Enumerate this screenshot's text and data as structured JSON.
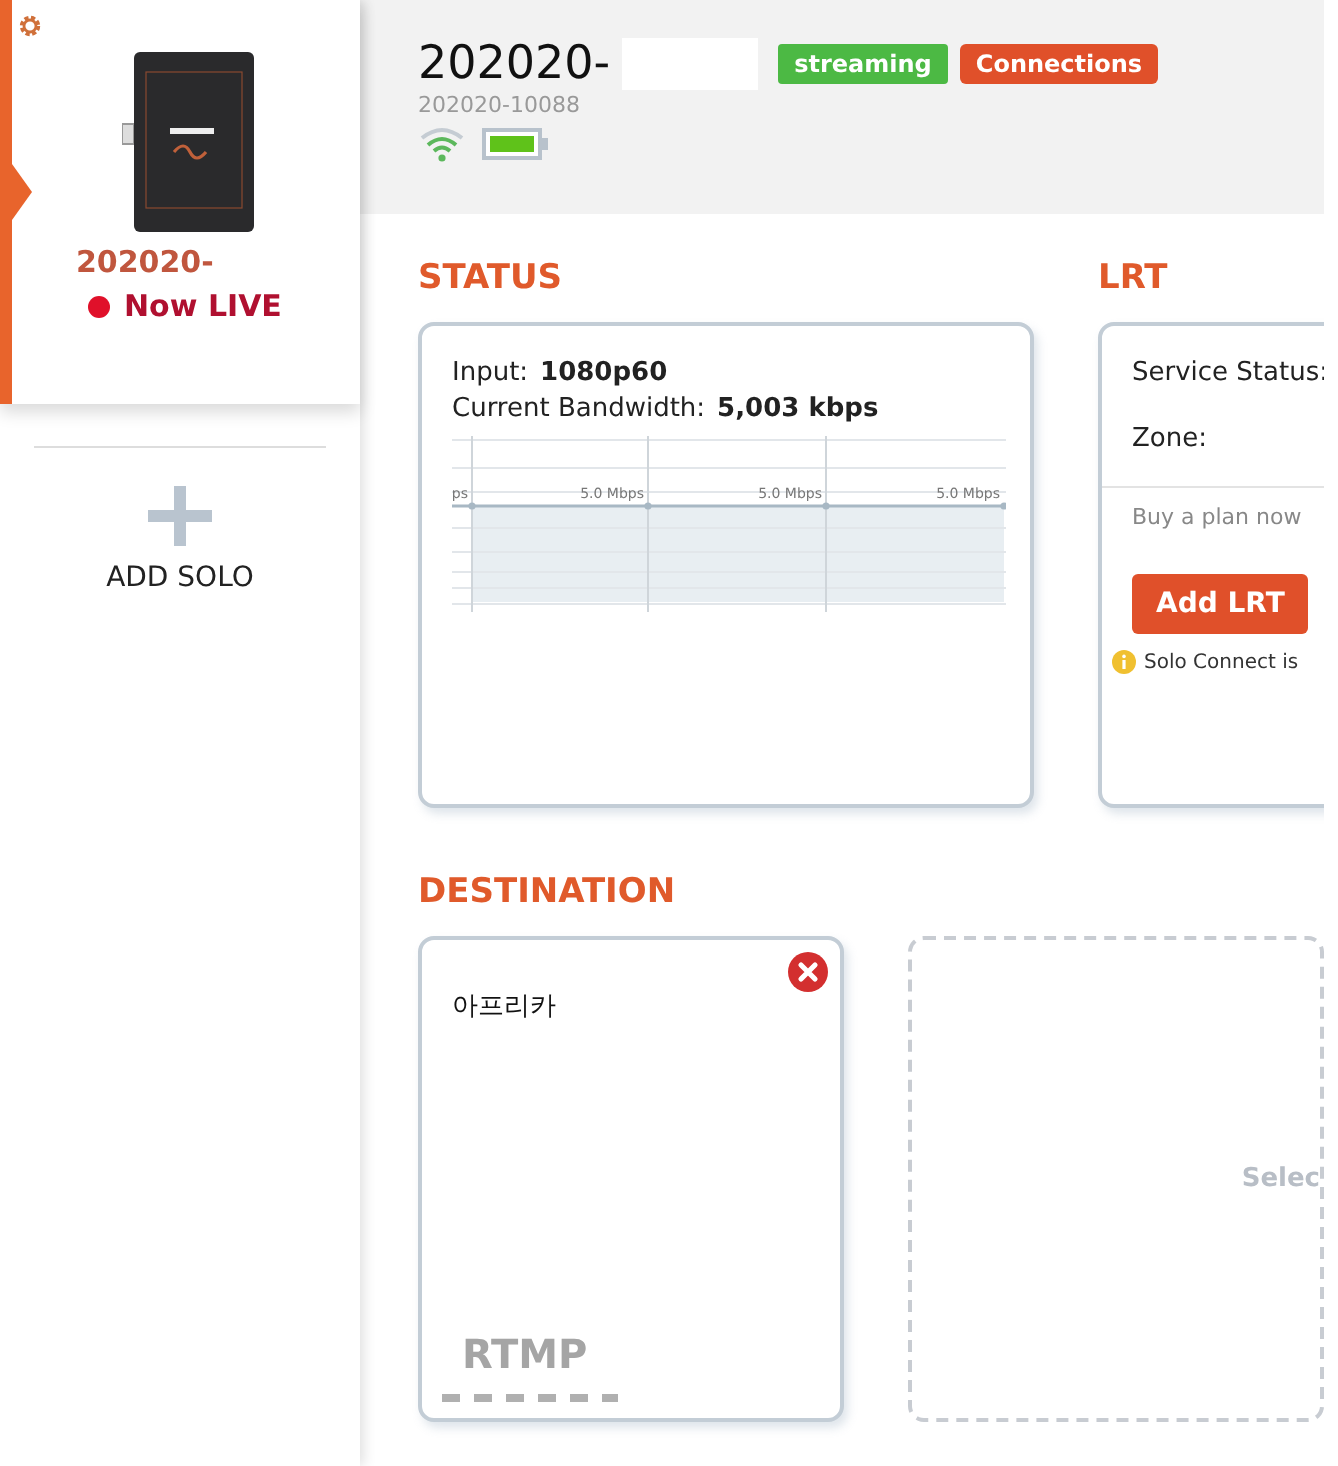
{
  "sidebar": {
    "device": {
      "name": "202020-",
      "status": "Now LIVE",
      "live": true,
      "selected": true
    },
    "add_button": "ADD SOLO"
  },
  "header": {
    "title": "202020-",
    "badges": [
      {
        "label": "streaming",
        "kind": "status"
      },
      {
        "label": "Connections",
        "kind": "action"
      }
    ],
    "serial": "202020-10088"
  },
  "status": {
    "heading": "STATUS",
    "fields": [
      {
        "label": "Input:",
        "value": "1080p60"
      },
      {
        "label": "Current Bandwidth:",
        "value": "5,003 kbps"
      }
    ],
    "graph_labels": [
      "ps",
      "5.0 Mbps",
      "5.0 Mbps",
      "5.0 Mbps"
    ]
  },
  "lrt": {
    "heading": "LRT",
    "fields": [
      "Service Status:",
      "Zone:"
    ],
    "note": "Buy a plan now",
    "button": "Add LRT",
    "info": "Solo Connect is"
  },
  "destination": {
    "heading": "DESTINATION",
    "cards": [
      {
        "kind": "destination",
        "name": "아프리카",
        "protocol": "RTMP"
      },
      {
        "kind": "placeholder",
        "label": "Selec"
      }
    ]
  }
}
